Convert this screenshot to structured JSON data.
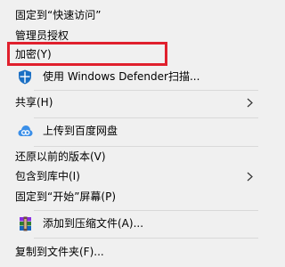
{
  "menu": {
    "items": [
      {
        "id": "pin-quick-access",
        "label": "固定到“快速访问”"
      },
      {
        "id": "admin-grant",
        "label": "管理员授权"
      },
      {
        "id": "encrypt",
        "label": "加密(Y)"
      },
      {
        "id": "defender-scan",
        "label": "使用 Windows Defender扫描...",
        "icon": "windows-defender-shield-icon"
      },
      {
        "id": "share",
        "label": "共享(H)",
        "submenu": true
      },
      {
        "id": "upload-baidu",
        "label": "上传到百度网盘",
        "icon": "baidu-netdisk-icon"
      },
      {
        "id": "restore-previous",
        "label": "还原以前的版本(V)"
      },
      {
        "id": "include-library",
        "label": "包含到库中(I)",
        "submenu": true
      },
      {
        "id": "pin-start",
        "label": "固定到“开始”屏幕(P)"
      },
      {
        "id": "add-archive",
        "label": "添加到压缩文件(A)...",
        "icon": "winrar-archive-icon"
      },
      {
        "id": "copy-folder",
        "label": "复制到文件夹(F)..."
      }
    ]
  },
  "colors": {
    "menu_bg": "#f0f0f0",
    "separator": "#d9d9d9",
    "highlight_border": "#e0202d",
    "text": "#000000"
  }
}
